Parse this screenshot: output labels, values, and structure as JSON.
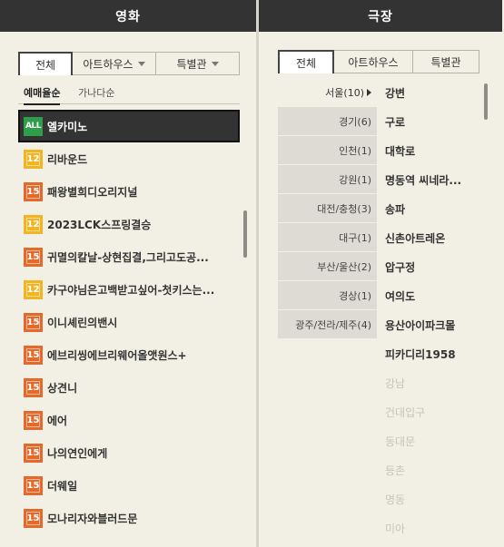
{
  "movie": {
    "title": "영화",
    "tabs": [
      {
        "label": "전체"
      },
      {
        "label": "아트하우스"
      },
      {
        "label": "특별관"
      }
    ],
    "sort": [
      {
        "label": "예매율순"
      },
      {
        "label": "가나다순"
      }
    ],
    "items": [
      {
        "rating": "ALL",
        "title": "엘카미노"
      },
      {
        "rating": "12",
        "title": "리바운드"
      },
      {
        "rating": "15",
        "title": "패왕별희디오리지널"
      },
      {
        "rating": "12",
        "title": "2023LCK스프링결승"
      },
      {
        "rating": "15",
        "title": "귀멸의칼날-상현집결,그리고도공..."
      },
      {
        "rating": "12",
        "title": "카구야님은고백받고싶어-첫키스는..."
      },
      {
        "rating": "15",
        "title": "이니셰린의밴시"
      },
      {
        "rating": "15",
        "title": "에브리씽에브리웨어올앳원스+"
      },
      {
        "rating": "15",
        "title": "상견니"
      },
      {
        "rating": "15",
        "title": "에어"
      },
      {
        "rating": "15",
        "title": "나의연인에게"
      },
      {
        "rating": "15",
        "title": "더웨일"
      },
      {
        "rating": "15",
        "title": "모나리자와블러드문"
      }
    ]
  },
  "theater": {
    "title": "극장",
    "tabs": [
      {
        "label": "전체"
      },
      {
        "label": "아트하우스"
      },
      {
        "label": "특별관"
      }
    ],
    "regions": [
      {
        "label": "서울(10)"
      },
      {
        "label": "경기(6)"
      },
      {
        "label": "인천(1)"
      },
      {
        "label": "강원(1)"
      },
      {
        "label": "대전/충청(3)"
      },
      {
        "label": "대구(1)"
      },
      {
        "label": "부산/울산(2)"
      },
      {
        "label": "경상(1)"
      },
      {
        "label": "광주/전라/제주(4)"
      }
    ],
    "theaters": [
      {
        "name": "강변"
      },
      {
        "name": "구로"
      },
      {
        "name": "대학로"
      },
      {
        "name": "명동역 씨네라..."
      },
      {
        "name": "송파"
      },
      {
        "name": "신촌아트레온"
      },
      {
        "name": "압구정"
      },
      {
        "name": "여의도"
      },
      {
        "name": "용산아이파크몰"
      },
      {
        "name": "피카디리1958"
      },
      {
        "name": "강남"
      },
      {
        "name": "건대입구"
      },
      {
        "name": "동대문"
      },
      {
        "name": "등촌"
      },
      {
        "name": "명동"
      },
      {
        "name": "미아"
      }
    ]
  }
}
